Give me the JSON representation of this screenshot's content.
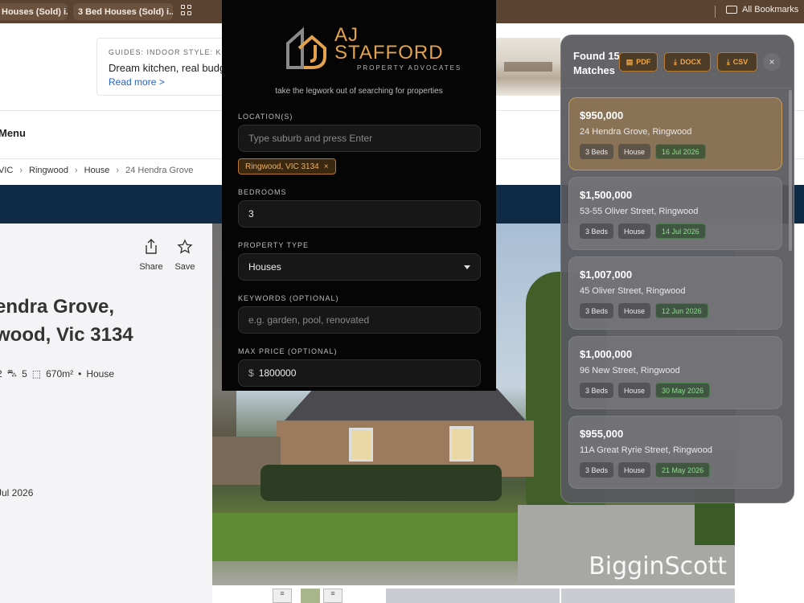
{
  "browser": {
    "bookmarks": [
      "Houses (Sold) i...",
      "3 Bed Houses (Sold) i..."
    ],
    "all_bookmarks": "All Bookmarks"
  },
  "guide": {
    "category": "GUIDES: INDOOR STYLE: KITCH",
    "title": "Dream kitchen, real budg",
    "link": "Read more >"
  },
  "page": {
    "menu": "Menu",
    "breadcrumbs": [
      "VIC",
      "Ringwood",
      "House",
      "24 Hendra Grove"
    ],
    "share": "Share",
    "save": "Save",
    "address_line1": "endra Grove,",
    "address_line2": "wood, Vic 3134",
    "features": {
      "baths": "2",
      "cars": "5",
      "land": "670m²",
      "sep": "•",
      "type": "House"
    },
    "sold_date": "Jul 2026",
    "watermark": "BigginScott"
  },
  "search": {
    "logo_line1": "AJ",
    "logo_line2": "STAFFORD",
    "logo_sub": "PROPERTY ADVOCATES",
    "tagline": "take the legwork out of searching for properties",
    "location_label": "LOCATION(S)",
    "location_placeholder": "Type suburb and press Enter",
    "location_chip": "Ringwood, VIC 3134",
    "chip_remove": "×",
    "bedrooms_label": "BEDROOMS",
    "bedrooms_value": "3",
    "type_label": "PROPERTY TYPE",
    "type_value": "Houses",
    "keywords_label": "KEYWORDS (OPTIONAL)",
    "keywords_placeholder": "e.g. garden, pool, renovated",
    "price_label": "MAX PRICE (OPTIONAL)",
    "price_prefix": "$",
    "price_value": "1800000"
  },
  "results": {
    "title_line1": "Found 15",
    "title_line2": "Matches",
    "exports": [
      "PDF",
      "DOCX",
      "CSV"
    ],
    "close": "×",
    "items": [
      {
        "price": "$950,000",
        "address": "24 Hendra Grove, Ringwood",
        "beds": "3 Beds",
        "type": "House",
        "date": "16 Jul 2026"
      },
      {
        "price": "$1,500,000",
        "address": "53-55 Oliver Street, Ringwood",
        "beds": "3 Beds",
        "type": "House",
        "date": "14 Jul 2026"
      },
      {
        "price": "$1,007,000",
        "address": "45 Oliver Street, Ringwood",
        "beds": "3 Beds",
        "type": "House",
        "date": "12 Jun 2026"
      },
      {
        "price": "$1,000,000",
        "address": "96 New Street, Ringwood",
        "beds": "3 Beds",
        "type": "House",
        "date": "30 May 2026"
      },
      {
        "price": "$955,000",
        "address": "11A Great Ryrie Street, Ringwood",
        "beds": "3 Beds",
        "type": "House",
        "date": "21 May 2026"
      }
    ]
  }
}
